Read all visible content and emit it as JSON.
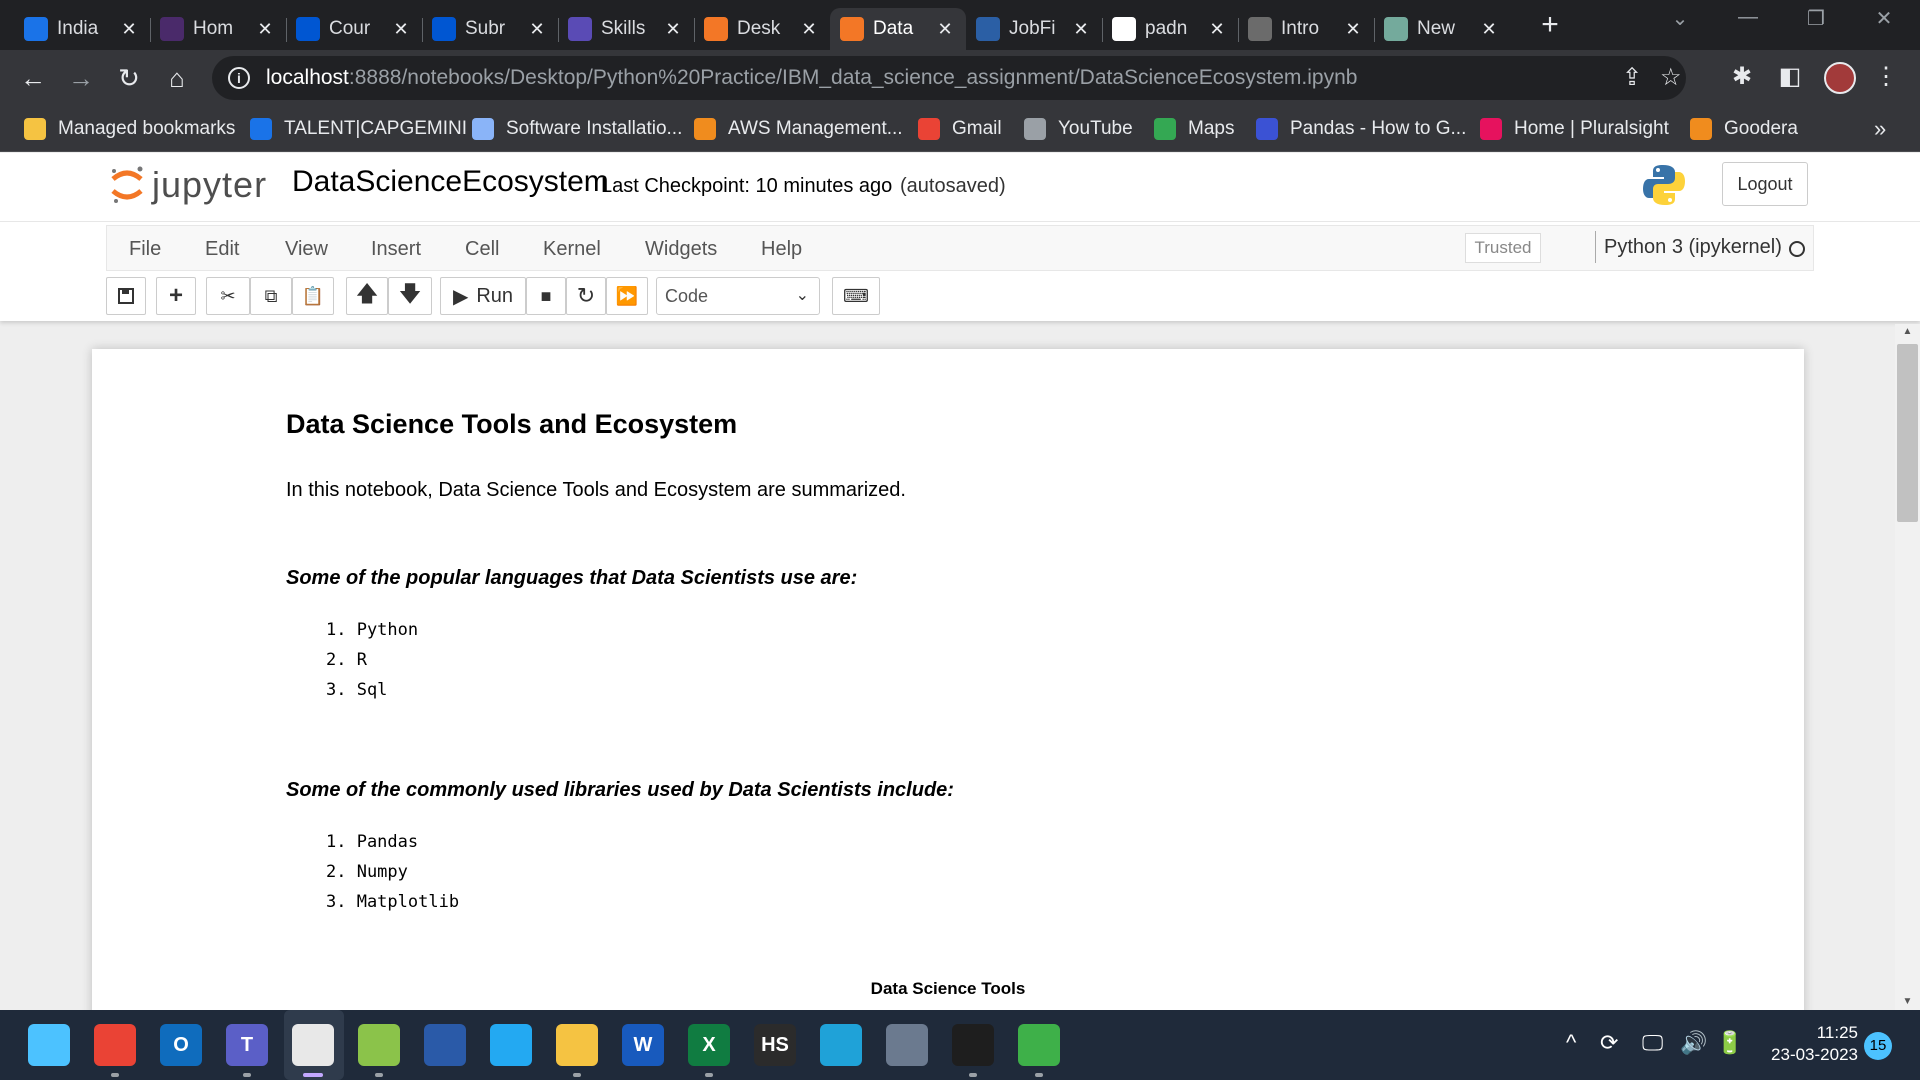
{
  "browser": {
    "tabs": [
      {
        "label": "India",
        "icon": "talent-t-icon",
        "color": "#1a73e8"
      },
      {
        "label": "Hom",
        "icon": "hackerrank-icon",
        "color": "#4a2a6a"
      },
      {
        "label": "Cour",
        "icon": "coursera-icon",
        "color": "#0056d2"
      },
      {
        "label": "Subr",
        "icon": "coursera-icon",
        "color": "#0056d2"
      },
      {
        "label": "Skills",
        "icon": "skillsnetwork-icon",
        "color": "#5a4bb5"
      },
      {
        "label": "Desk",
        "icon": "jupyter-icon",
        "color": "#f37726"
      },
      {
        "label": "Data",
        "icon": "notebook-icon",
        "color": "#f37726"
      },
      {
        "label": "JobFi",
        "icon": "pega-icon",
        "color": "#2b5fa5"
      },
      {
        "label": "padn",
        "icon": "github-icon",
        "color": "#ffffff"
      },
      {
        "label": "Intro",
        "icon": "openai-icon",
        "color": "#6b6b6b"
      },
      {
        "label": "New",
        "icon": "chatgpt-icon",
        "color": "#74aa9c"
      }
    ],
    "active_tab_index": 6,
    "url_host": "localhost",
    "url_path": ":8888/notebooks/Desktop/Python%20Practice/IBM_data_science_assignment/DataScienceEcosystem.ipynb",
    "bookmarks": [
      {
        "label": "Managed bookmarks",
        "icon": "folder-icon",
        "color": "#f5c342"
      },
      {
        "label": "TALENT|CAPGEMINI",
        "icon": "talent-t-icon",
        "color": "#1a73e8"
      },
      {
        "label": "Software Installatio...",
        "icon": "globe-icon",
        "color": "#8ab4f8"
      },
      {
        "label": "AWS Management...",
        "icon": "aws-cube-icon",
        "color": "#f08c1e"
      },
      {
        "label": "Gmail",
        "icon": "gmail-icon",
        "color": "#ea4335"
      },
      {
        "label": "YouTube",
        "icon": "globe-icon",
        "color": "#9aa0a6"
      },
      {
        "label": "Maps",
        "icon": "maps-icon",
        "color": "#34a853"
      },
      {
        "label": "Pandas - How to G...",
        "icon": "pandas-s-icon",
        "color": "#3b52d4"
      },
      {
        "label": "Home | Pluralsight",
        "icon": "pluralsight-icon",
        "color": "#e6125e"
      },
      {
        "label": "Goodera",
        "icon": "goodera-icon",
        "color": "#f08c1e"
      }
    ]
  },
  "jupyter": {
    "logo_text": "jupyter",
    "notebook_name": "DataScienceEcosystem",
    "checkpoint": "Last Checkpoint: 10 minutes ago",
    "autosaved": "(autosaved)",
    "logout": "Logout",
    "menus": [
      "File",
      "Edit",
      "View",
      "Insert",
      "Cell",
      "Kernel",
      "Widgets",
      "Help"
    ],
    "trusted": "Trusted",
    "kernel": "Python 3 (ipykernel)",
    "run_label": "Run",
    "cell_type": "Code"
  },
  "notebook": {
    "heading": "Data Science Tools and Ecosystem",
    "intro": "In this notebook, Data Science Tools and Ecosystem are summarized.",
    "languages_heading": "Some of the popular languages that Data Scientists use are:",
    "languages": [
      "1. Python",
      "2. R",
      "3. Sql"
    ],
    "libraries_heading": "Some of the commonly used libraries used by Data Scientists include:",
    "libraries": [
      "1. Pandas",
      "2. Numpy",
      "3. Matplotlib"
    ],
    "tools_heading": "Data Science Tools"
  },
  "taskbar": {
    "apps": [
      {
        "name": "start-icon",
        "color": "#4cc2ff"
      },
      {
        "name": "chrome-icon",
        "color": "#ea4335"
      },
      {
        "name": "outlook-icon",
        "color": "#0f6cbd",
        "text": "O"
      },
      {
        "name": "teams-icon",
        "color": "#5b5fc7",
        "text": "T"
      },
      {
        "name": "snipping-tool-icon",
        "color": "#e8e8e8"
      },
      {
        "name": "notepad-plus-icon",
        "color": "#8bc34a"
      },
      {
        "name": "powershell-icon",
        "color": "#2a5aa8"
      },
      {
        "name": "vscode-icon",
        "color": "#23a9f2"
      },
      {
        "name": "file-explorer-icon",
        "color": "#f5c342"
      },
      {
        "name": "word-icon",
        "color": "#185abd",
        "text": "W"
      },
      {
        "name": "excel-icon",
        "color": "#107c41",
        "text": "X"
      },
      {
        "name": "hs-icon",
        "color": "#2b2b2b",
        "text": "HS"
      },
      {
        "name": "edge-icon",
        "color": "#1fa2d8"
      },
      {
        "name": "calculator-icon",
        "color": "#6b7a8f"
      },
      {
        "name": "terminal-icon",
        "color": "#1e1e1e"
      },
      {
        "name": "anaconda-icon",
        "color": "#3eb049"
      }
    ],
    "time": "11:25",
    "date": "23-03-2023",
    "notifications": "15"
  }
}
